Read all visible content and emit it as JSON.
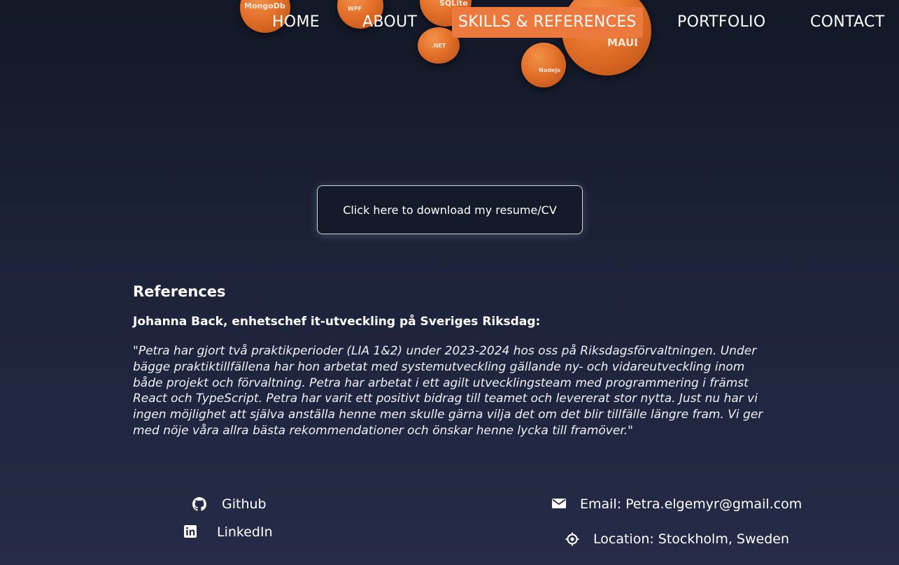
{
  "skill_bubbles": [
    "MongoDb",
    "WPF",
    "SQLite",
    ".NET",
    "MAUI",
    "Nodejs"
  ],
  "nav": {
    "items": [
      "HOME",
      "ABOUT",
      "SKILLS & REFERENCES",
      "PORTFOLIO",
      "CONTACT"
    ],
    "active": "SKILLS & REFERENCES"
  },
  "resume_button": "Click here to download my resume/CV",
  "references": {
    "title": "References",
    "items": [
      {
        "author": "Johanna Back, enhetschef it-utveckling på Sveriges Riksdag:",
        "quote": "\"Petra har gjort två praktikperioder (LIA 1&2) under 2023-2024 hos oss på Riksdagsförvaltningen. Under bägge praktiktillfällena har hon arbetat med systemutveckling gällande ny- och vidareutveckling inom både projekt och förvaltning. Petra har arbetat i ett agilt utvecklingsteam med programmering i främst React och TypeScript. Petra har varit ett positivt bidrag till teamet och levererat stor nytta. Just nu har vi ingen möjlighet att själva anställa henne men skulle gärna vilja det om det blir tillfälle längre fram. Vi ger med nöje våra allra bästa rekommendationer och önskar henne lycka till framöver.\""
      }
    ]
  },
  "footer": {
    "github": {
      "icon": "github-icon",
      "label": "Github"
    },
    "linkedin": {
      "icon": "linkedin-icon",
      "label": "LinkedIn"
    },
    "email": {
      "icon": "envelope-icon",
      "label": "Email: Petra.elgemyr@gmail.com"
    },
    "location": {
      "icon": "location-icon",
      "label": "Location: Stockholm, Sweden"
    }
  },
  "colors": {
    "accent": "#ec7a3e",
    "background_top": "#131827",
    "background_bottom": "#262b48",
    "bubble": "#e3702a"
  }
}
